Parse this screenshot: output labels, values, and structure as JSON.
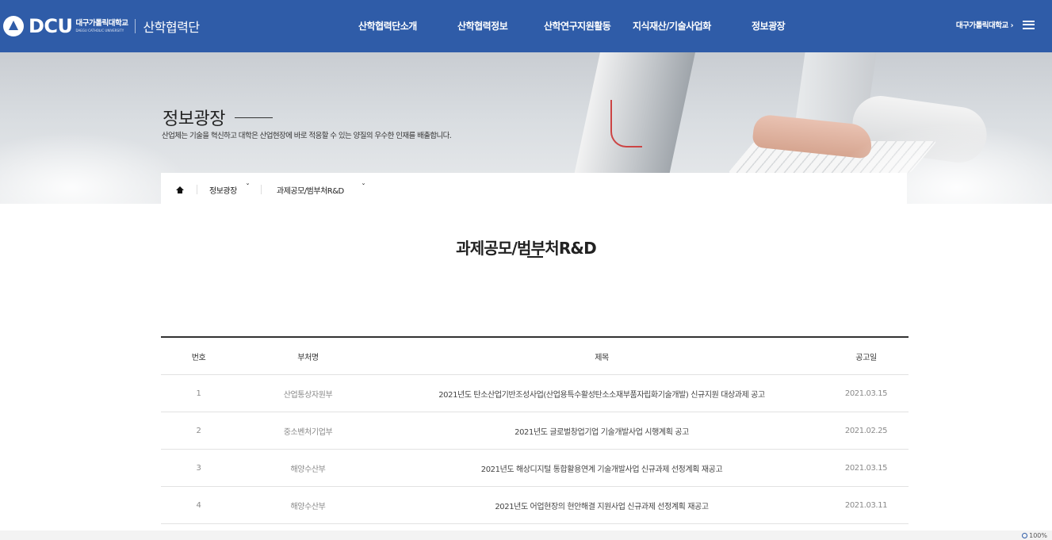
{
  "header": {
    "logo_text": "DCU",
    "logo_univ_ko": "대구가톨릭대학교",
    "logo_univ_en": "DAEGU CATHOLIC UNIVERSITY",
    "org_name": "산학협력단",
    "nav": [
      "산학협력단소개",
      "산학협력정보",
      "산학연구지원활동",
      "지식재산/기술사업화",
      "정보광장"
    ],
    "univ_link": "대구가톨릭대학교",
    "univ_link_arrow": "›",
    "menu_icon": "hamburger-menu-icon",
    "brand_color": "#2f5ca8"
  },
  "hero": {
    "title": "정보광장",
    "description": "산업체는 기술을 혁신하고 대학은 산업현장에 바로 적응할 수 있는 양질의 우수한 인재를 배출합니다."
  },
  "breadcrumb": {
    "home_icon": "home-icon",
    "items": [
      "정보광장",
      "과제공모/범부처R&D"
    ],
    "chevron": "ˇ"
  },
  "page": {
    "title": "과제공모/범부처R&D"
  },
  "board": {
    "columns": [
      "번호",
      "부처명",
      "제목",
      "공고일"
    ],
    "rows": [
      {
        "no": "1",
        "dept": "산업통상자원부",
        "title": "2021년도 탄소산업기반조성사업(산업용특수활성탄소소재부품자립화기술개발) 신규지원 대상과제 공고",
        "date": "2021.03.15"
      },
      {
        "no": "2",
        "dept": "중소벤처기업부",
        "title": "2021년도 글로벌창업기업 기술개발사업 시행계획 공고",
        "date": "2021.02.25"
      },
      {
        "no": "3",
        "dept": "해양수산부",
        "title": "2021년도 해상디지털 통합활용연계 기술개발사업 신규과제 선정계획 재공고",
        "date": "2021.03.15"
      },
      {
        "no": "4",
        "dept": "해양수산부",
        "title": "2021년도 어업현장의 현안해결 지원사업 신규과제 선정계획 재공고",
        "date": "2021.03.11"
      }
    ]
  },
  "statusbar": {
    "zoom": "100%"
  }
}
